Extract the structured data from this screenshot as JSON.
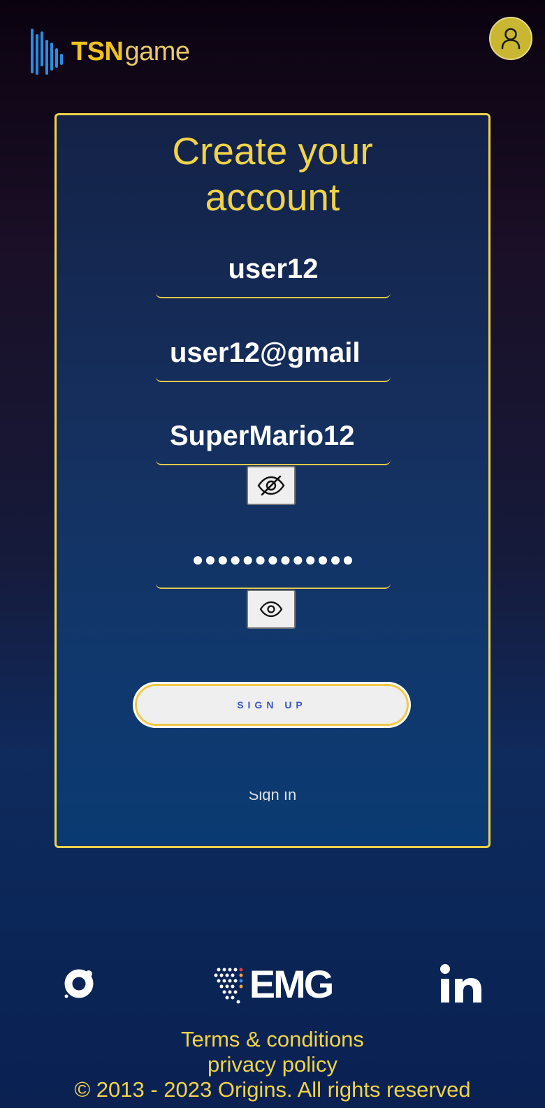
{
  "header": {
    "logo_primary": "TSN",
    "logo_secondary": "game"
  },
  "form": {
    "title_line1": "Create your",
    "title_line2": "account",
    "username_value": "user12",
    "email_value": "user12@gmail",
    "password_value": "SuperMario12",
    "confirm_password_value": "●●●●●●●●●●●●●",
    "signup_label": "SIGN UP",
    "faded_text": "Sign In"
  },
  "footer": {
    "brand_logo": "EMG",
    "terms_label": "Terms & conditions",
    "privacy_label": "privacy policy",
    "copyright": "© 2013 - 2023 Origins. All rights reserved"
  },
  "icons": {
    "avatar": "user-icon",
    "password_toggle": "eye-off-icon",
    "confirm_toggle": "eye-icon",
    "social_left": "origins-icon",
    "social_right": "linkedin-icon"
  },
  "colors": {
    "accent": "#f0d34a",
    "avatar_bg": "#c9b731",
    "button_text": "#3a56c9"
  }
}
